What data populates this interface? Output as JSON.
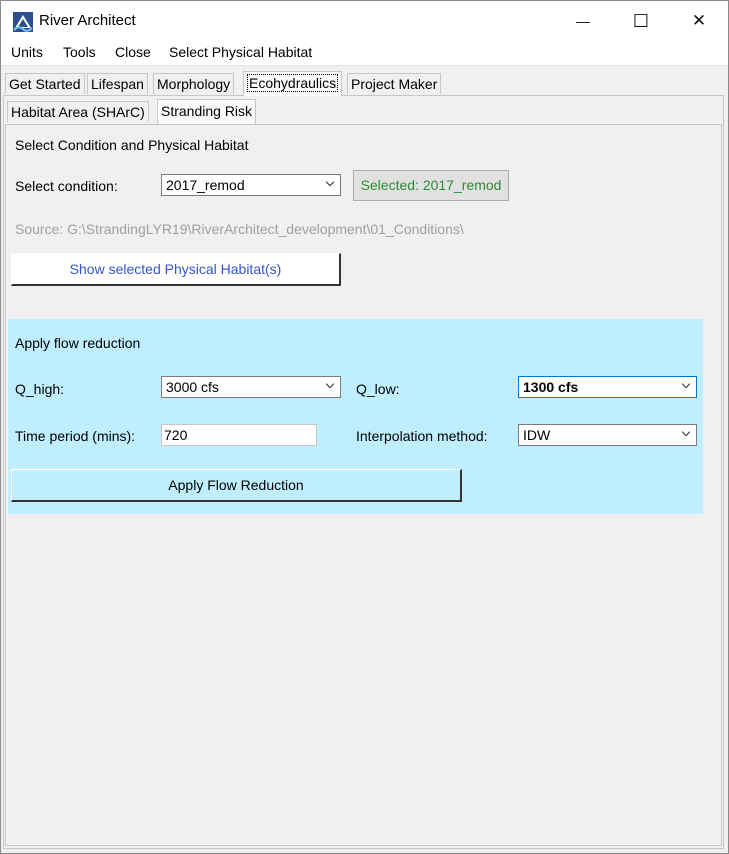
{
  "window": {
    "title": "River Architect",
    "controls": {
      "minimize": "—",
      "maximize": "☐",
      "close": "✕"
    }
  },
  "menu": [
    "Units",
    "Tools",
    "Close",
    "Select Physical Habitat"
  ],
  "tabs": [
    {
      "label": "Get Started",
      "active": false
    },
    {
      "label": "Lifespan",
      "active": false
    },
    {
      "label": "Morphology",
      "active": false
    },
    {
      "label": "Ecohydraulics",
      "active": true
    },
    {
      "label": "Project Maker",
      "active": false
    }
  ],
  "subtabs": [
    {
      "label": "Habitat Area (SHArC)",
      "active": false
    },
    {
      "label": "Stranding Risk",
      "active": true
    }
  ],
  "condition_section": {
    "title": "Select Condition and Physical Habitat",
    "condition_label": "Select condition:",
    "condition_value": "2017_remod",
    "selected_button": "Selected: 2017_remod",
    "source_text": "Source: G:\\StrandingLYR19\\RiverArchitect_development\\01_Conditions\\",
    "show_habitat_button": "Show selected Physical Habitat(s)"
  },
  "flow_section": {
    "title": "Apply flow reduction",
    "q_high_label": "Q_high:",
    "q_high_value": "3000 cfs",
    "q_low_label": "Q_low:",
    "q_low_value": "1300 cfs",
    "time_label": "Time period (mins):",
    "time_value": "720",
    "interp_label": "Interpolation method:",
    "interp_value": "IDW",
    "apply_button": "Apply Flow Reduction"
  },
  "colors": {
    "flow_panel_bg": "#bfeeff",
    "selected_text": "#2e8b2e",
    "link_text": "#3355cc",
    "source_text": "#a0a0a0"
  }
}
